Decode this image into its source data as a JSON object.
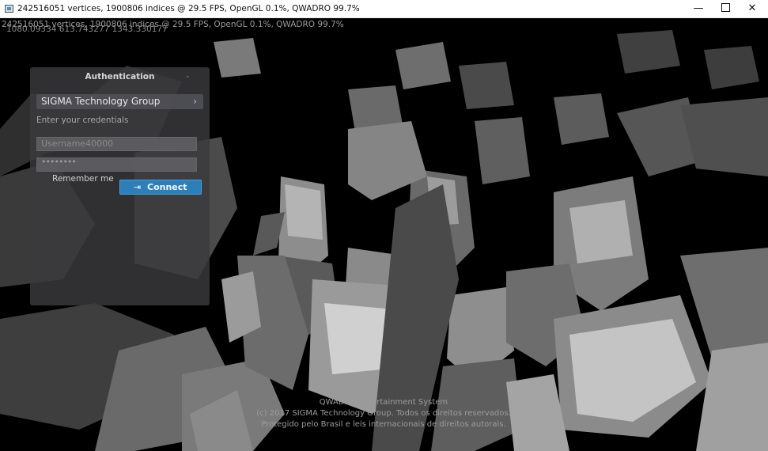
{
  "window": {
    "title": "242516051 vertices, 1900806 indices @ 29.5 FPS, OpenGL 0.1%, QWADRO 99.7%",
    "minimize_glyph": "—",
    "close_glyph": "✕",
    "icon": "app-window-icon"
  },
  "hud": {
    "stats": "242516051 vertices, 1900806 indices @ 29.5 FPS, OpenGL 0.1%, QWADRO 99.7%",
    "coords": "1080.09334 613.743277 1343.330177"
  },
  "login": {
    "title": "Authentication",
    "collapse_glyph": "⌄",
    "organization": "SIGMA Technology Group",
    "organization_arrow": "›",
    "instruction": "Enter your credentials",
    "username": "Username40000",
    "password": "••••••••",
    "remember_label": "Remember me",
    "connect_icon": "⇥",
    "connect_label": "Connect",
    "accent_color": "#2c7fb8"
  },
  "footer": {
    "line1": "QWADRO Entertainment System",
    "line2": "(c) 2017 SIGMA Technology Group. Todos os direitos reservados.",
    "line3": "Protegido pelo Brasil e leis internacionais de direitos autorais."
  }
}
